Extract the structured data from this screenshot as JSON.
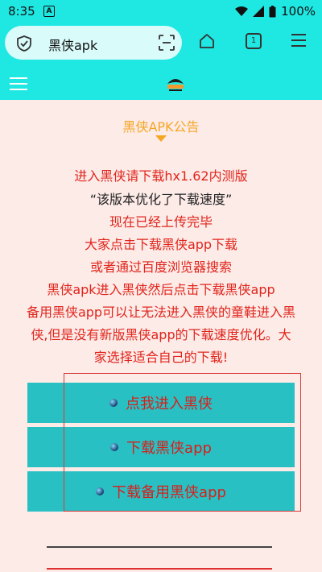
{
  "status": {
    "time": "8:35",
    "battery": "100%"
  },
  "browser": {
    "url_title": "黑侠apk",
    "tab_count": "1"
  },
  "notice": {
    "title": "黑侠APK公告",
    "lines": [
      "进入黑侠请下载hx1.62内测版",
      "“该版本优化了下载速度”",
      "现在已经上传完毕",
      "大家点击下载黑侠app下载",
      "或者通过百度浏览器搜索",
      "黑侠apk进入黑侠然后点击下载黑侠app",
      "备用黑侠app可以让无法进入黑侠的童鞋进入黑",
      "侠,但是没有新版黑侠app的下载速度优化。大",
      "家选择适合自己的下载!"
    ]
  },
  "buttons": {
    "enter": "点我进入黑侠",
    "download": "下载黑侠app",
    "download_backup": "下载备用黑侠app"
  },
  "colors": {
    "accent": "#1fe7e2",
    "button_bg": "#29c0c4",
    "text_red": "#e0251c",
    "title_orange": "#f5a623",
    "page_bg": "#fdebe8"
  }
}
